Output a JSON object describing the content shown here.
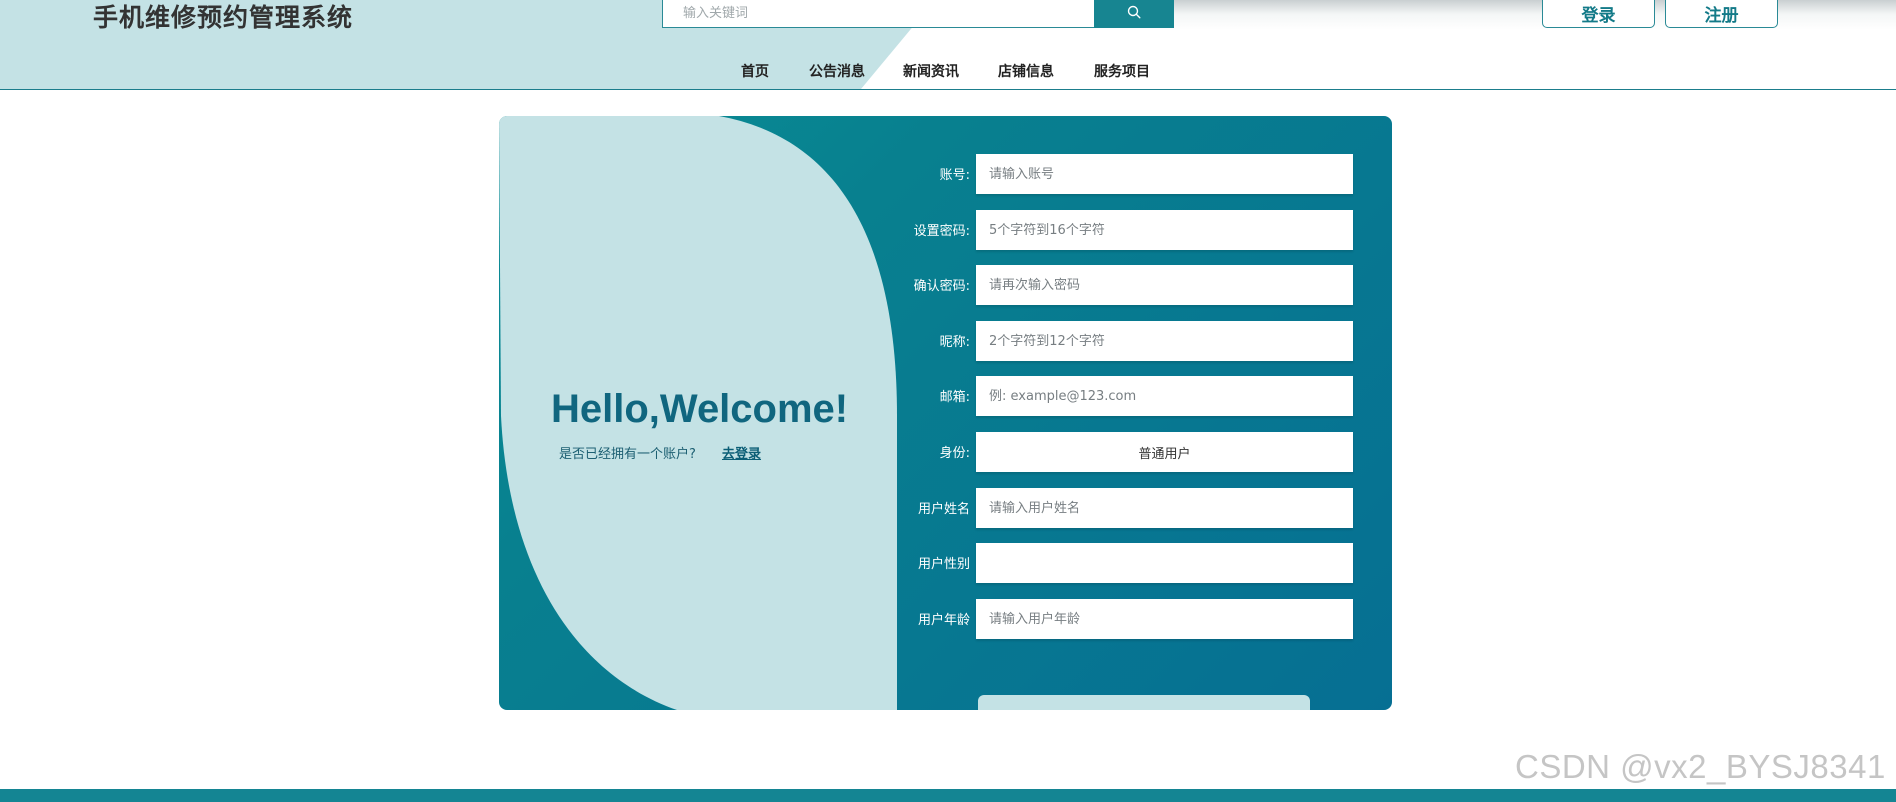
{
  "header": {
    "site_title": "手机维修预约管理系统",
    "search_placeholder": "输入关键词",
    "login_label": "登录",
    "register_label": "注册"
  },
  "nav": {
    "items": [
      {
        "label": "首页"
      },
      {
        "label": "公告消息"
      },
      {
        "label": "新闻资讯"
      },
      {
        "label": "店铺信息"
      },
      {
        "label": "服务项目"
      }
    ]
  },
  "welcome": {
    "hello": "Hello,Welcome!",
    "have_account": "是否已经拥有一个账户?",
    "go_login": "去登录"
  },
  "form": {
    "fields": [
      {
        "label": "账号:",
        "placeholder": "请输入账号",
        "value": ""
      },
      {
        "label": "设置密码:",
        "placeholder": "5个字符到16个字符",
        "value": ""
      },
      {
        "label": "确认密码:",
        "placeholder": "请再次输入密码",
        "value": ""
      },
      {
        "label": "昵称:",
        "placeholder": "2个字符到12个字符",
        "value": ""
      },
      {
        "label": "邮箱:",
        "placeholder": "例: example@123.com",
        "value": ""
      },
      {
        "label": "身份:",
        "selected": "普通用户"
      },
      {
        "label": "用户姓名",
        "placeholder": "请输入用户姓名",
        "value": ""
      },
      {
        "label": "用户性别",
        "selected": ""
      },
      {
        "label": "用户年龄",
        "placeholder": "请输入用户年龄",
        "value": ""
      }
    ]
  },
  "watermark": "CSDN @vx2_BYSJ8341",
  "colors": {
    "primary": "#178591",
    "card_dark": "#066f93",
    "card_teal": "#0a8e96",
    "blob": "#c4e2e5",
    "hello_text": "#10667f"
  },
  "icons": {
    "search": "magnifier"
  }
}
